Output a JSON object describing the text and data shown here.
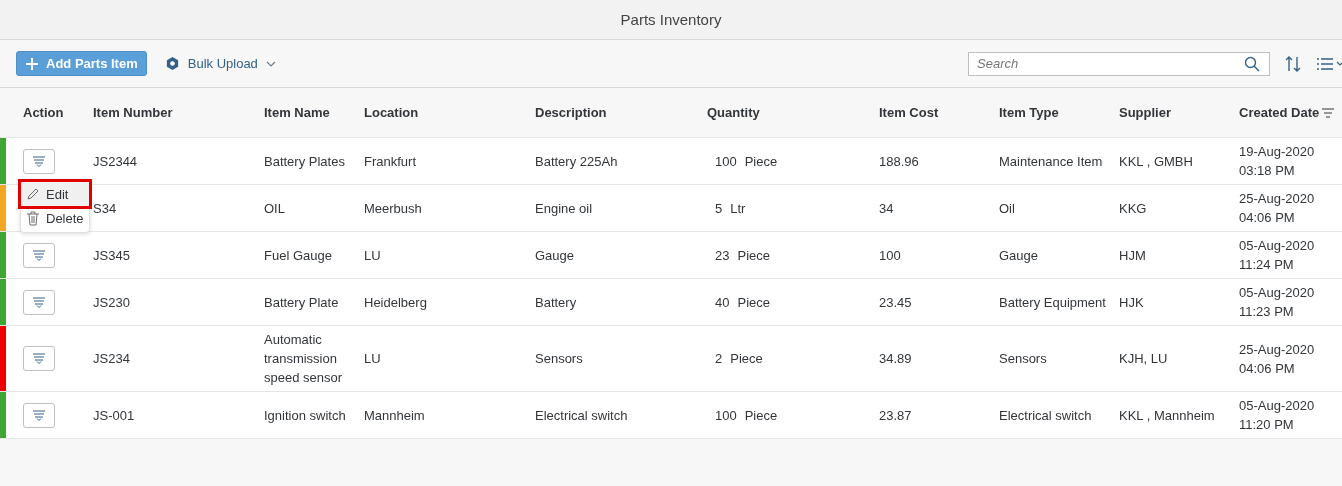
{
  "window": {
    "title": "Parts Inventory"
  },
  "toolbar": {
    "add_button": "Add Parts Item",
    "bulk_upload": "Bulk Upload",
    "search": {
      "placeholder": "Search"
    }
  },
  "table": {
    "columns": [
      "Action",
      "Item Number",
      "Item Name",
      "Location",
      "Description",
      "Quantity",
      "Item Cost",
      "Item Type",
      "Supplier",
      "Created Date"
    ],
    "rows": [
      {
        "color": "#3fa535",
        "item_number": "JS2344",
        "item_name": "Battery Plates",
        "location": "Frankfurt",
        "description": "Battery 225Ah",
        "quantity": "100",
        "unit": "Piece",
        "item_cost": "188.96",
        "item_type": "Maintenance Item",
        "supplier": "KKL , GMBH",
        "date": "19-Aug-2020",
        "time": "03:18 PM"
      },
      {
        "color": "#f5a623",
        "item_number": "S34",
        "item_name": "OIL",
        "location": "Meerbush",
        "description": "Engine oil",
        "quantity": "5",
        "unit": "Ltr",
        "item_cost": "34",
        "item_type": "Oil",
        "supplier": "KKG",
        "date": "25-Aug-2020",
        "time": "04:06 PM"
      },
      {
        "color": "#3fa535",
        "item_number": "JS345",
        "item_name": "Fuel Gauge",
        "location": "LU",
        "description": "Gauge",
        "quantity": "23",
        "unit": "Piece",
        "item_cost": "100",
        "item_type": "Gauge",
        "supplier": "HJM",
        "date": "05-Aug-2020",
        "time": "11:24 PM"
      },
      {
        "color": "#3fa535",
        "item_number": "JS230",
        "item_name": "Battery Plate",
        "location": "Heidelberg",
        "description": "Battery",
        "quantity": "40",
        "unit": "Piece",
        "item_cost": "23.45",
        "item_type": "Battery Equipment",
        "supplier": "HJK",
        "date": "05-Aug-2020",
        "time": "11:23 PM"
      },
      {
        "color": "#ee0000",
        "item_number": "JS234",
        "item_name": "Automatic transmission speed sensor",
        "location": "LU",
        "description": "Sensors",
        "quantity": "2",
        "unit": "Piece",
        "item_cost": "34.89",
        "item_type": "Sensors",
        "supplier": "KJH, LU",
        "date": "25-Aug-2020",
        "time": "04:06 PM"
      },
      {
        "color": "#3fa535",
        "item_number": "JS-001",
        "item_name": "Ignition switch",
        "location": "Mannheim",
        "description": "Electrical switch",
        "quantity": "100",
        "unit": "Piece",
        "item_cost": "23.87",
        "item_type": "Electrical switch",
        "supplier": "KKL , Mannheim",
        "date": "05-Aug-2020",
        "time": "11:20 PM"
      }
    ]
  },
  "action_menu": {
    "items": [
      {
        "kind": "edit",
        "label": "Edit",
        "highlighted": true
      },
      {
        "kind": "delete",
        "label": "Delete",
        "highlighted": false
      }
    ]
  }
}
